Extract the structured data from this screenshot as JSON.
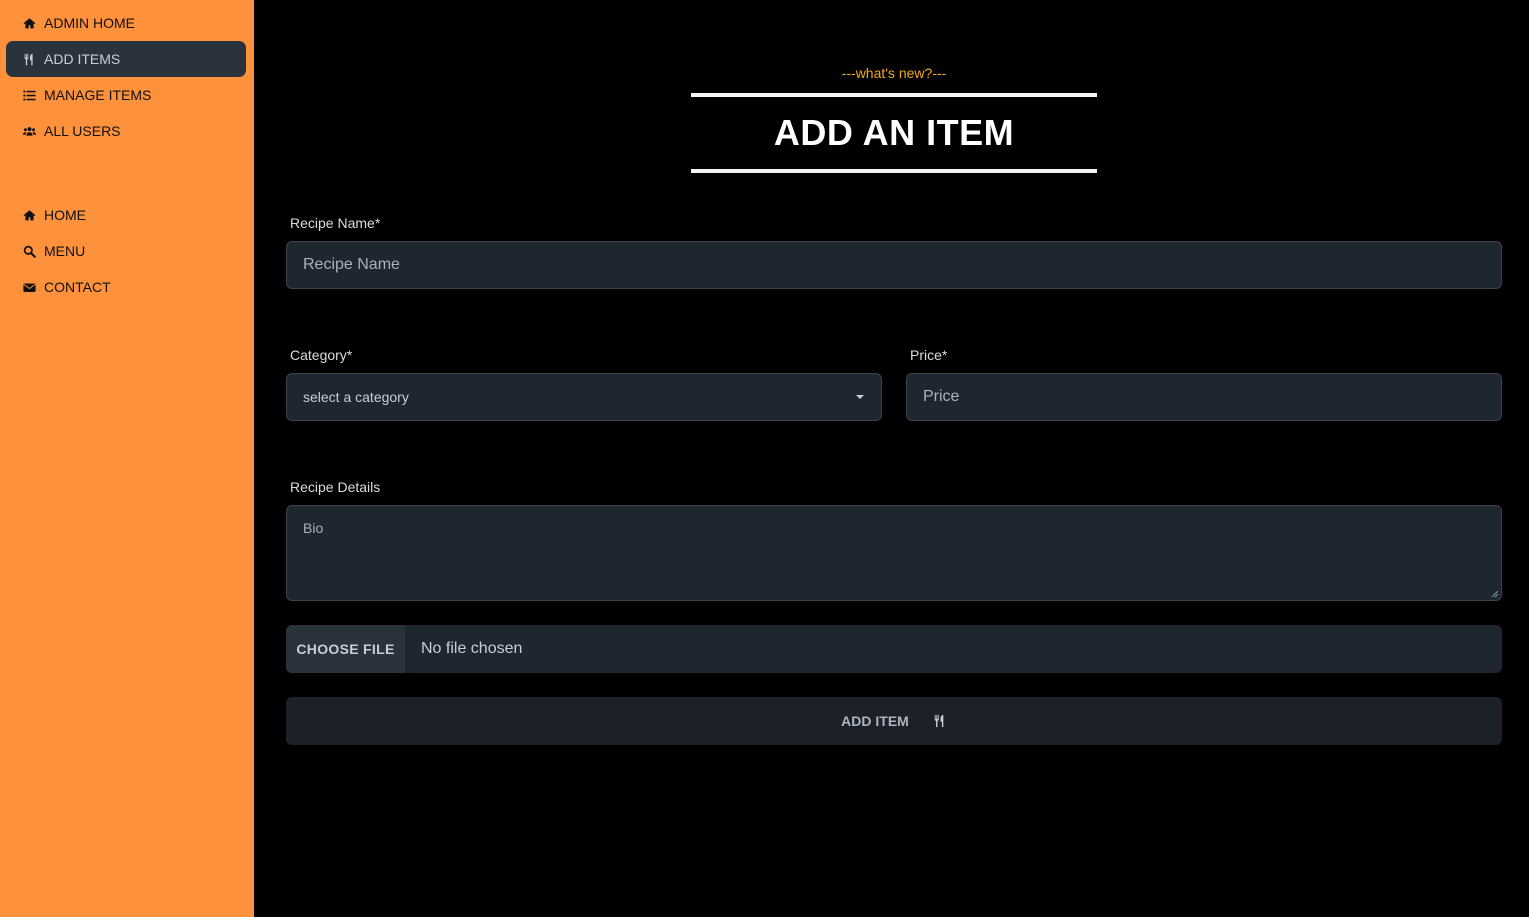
{
  "sidebar": {
    "admin_items": [
      {
        "label": "ADMIN HOME",
        "icon": "home-icon",
        "active": false
      },
      {
        "label": "ADD ITEMS",
        "icon": "utensils-icon",
        "active": true
      },
      {
        "label": "MANAGE ITEMS",
        "icon": "list-icon",
        "active": false
      },
      {
        "label": "ALL USERS",
        "icon": "users-icon",
        "active": false
      }
    ],
    "site_items": [
      {
        "label": "HOME",
        "icon": "home-icon"
      },
      {
        "label": "MENU",
        "icon": "search-icon"
      },
      {
        "label": "CONTACT",
        "icon": "envelope-icon"
      }
    ]
  },
  "heading": {
    "subheading": "---what's new?---",
    "title": "ADD AN ITEM"
  },
  "form": {
    "recipe_name": {
      "label": "Recipe Name*",
      "placeholder": "Recipe Name"
    },
    "category": {
      "label": "Category*",
      "value": "select a category"
    },
    "price": {
      "label": "Price*",
      "placeholder": "Price"
    },
    "details": {
      "label": "Recipe Details",
      "placeholder": "Bio"
    },
    "file": {
      "button_label": "CHOOSE FILE",
      "status": "No file chosen"
    },
    "submit_label": "ADD ITEM"
  },
  "colors": {
    "sidebar_bg": "#fe913b",
    "active_item_bg": "#2a323c",
    "accent": "#f2a91e",
    "input_bg": "#1f2630"
  }
}
